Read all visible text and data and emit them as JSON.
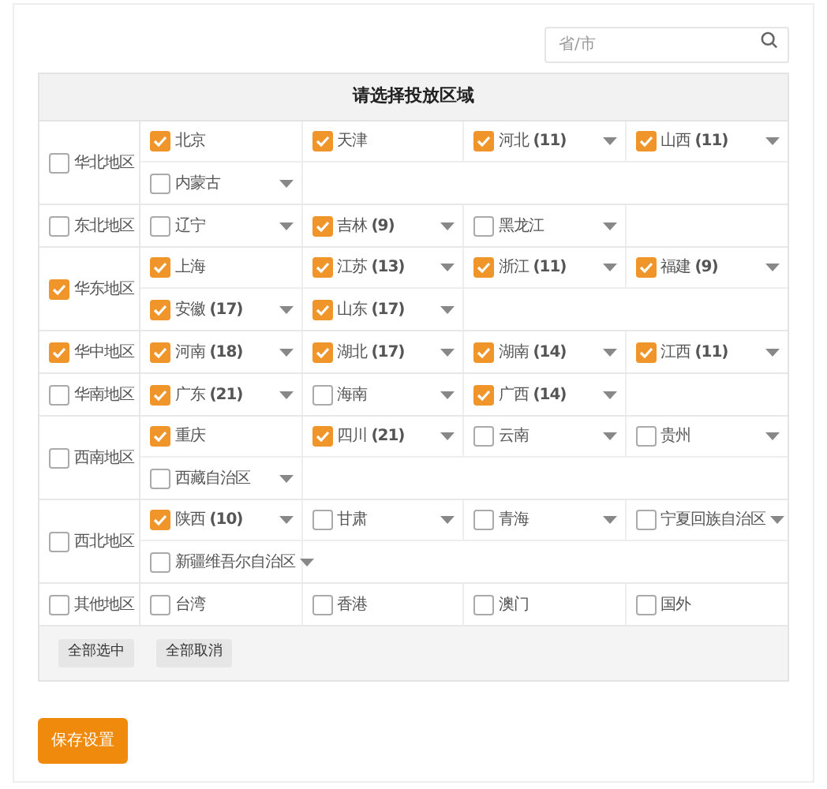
{
  "search": {
    "placeholder": "省/市"
  },
  "table": {
    "title": "请选择投放区域",
    "regions": [
      {
        "name": "华北地区",
        "checked": false,
        "rows": [
          [
            {
              "label": "北京",
              "checked": true,
              "caret": false
            },
            {
              "label": "天津",
              "checked": true,
              "caret": false
            },
            {
              "label": "河北 **(11)**",
              "checked": true,
              "caret": true
            },
            {
              "label": "山西 **(11)**",
              "checked": true,
              "caret": true
            }
          ],
          [
            {
              "label": "内蒙古",
              "checked": false,
              "caret": true
            }
          ]
        ]
      },
      {
        "name": "东北地区",
        "checked": false,
        "rows": [
          [
            {
              "label": "辽宁",
              "checked": false,
              "caret": true
            },
            {
              "label": "吉林 **(9)**",
              "checked": true,
              "caret": true
            },
            {
              "label": "黑龙江",
              "checked": false,
              "caret": true
            }
          ]
        ]
      },
      {
        "name": "华东地区",
        "checked": true,
        "rows": [
          [
            {
              "label": "上海",
              "checked": true,
              "caret": false
            },
            {
              "label": "江苏 **(13)**",
              "checked": true,
              "caret": true
            },
            {
              "label": "浙江 **(11)**",
              "checked": true,
              "caret": true
            },
            {
              "label": "福建 **(9)**",
              "checked": true,
              "caret": true
            }
          ],
          [
            {
              "label": "安徽 **(17)**",
              "checked": true,
              "caret": true
            },
            {
              "label": "山东 **(17)**",
              "checked": true,
              "caret": true
            }
          ]
        ]
      },
      {
        "name": "华中地区",
        "checked": true,
        "rows": [
          [
            {
              "label": "河南 **(18)**",
              "checked": true,
              "caret": true
            },
            {
              "label": "湖北 **(17)**",
              "checked": true,
              "caret": true
            },
            {
              "label": "湖南 **(14)**",
              "checked": true,
              "caret": true
            },
            {
              "label": "江西 **(11)**",
              "checked": true,
              "caret": true
            }
          ]
        ]
      },
      {
        "name": "华南地区",
        "checked": false,
        "rows": [
          [
            {
              "label": "广东 **(21)**",
              "checked": true,
              "caret": true
            },
            {
              "label": "海南",
              "checked": false,
              "caret": true
            },
            {
              "label": "广西 **(14)**",
              "checked": true,
              "caret": true
            }
          ]
        ]
      },
      {
        "name": "西南地区",
        "checked": false,
        "rows": [
          [
            {
              "label": "重庆",
              "checked": true,
              "caret": false
            },
            {
              "label": "四川 **(21)**",
              "checked": true,
              "caret": true
            },
            {
              "label": "云南",
              "checked": false,
              "caret": true
            },
            {
              "label": "贵州",
              "checked": false,
              "caret": true
            }
          ],
          [
            {
              "label": "西藏自治区",
              "checked": false,
              "caret": true
            }
          ]
        ]
      },
      {
        "name": "西北地区",
        "checked": false,
        "rows": [
          [
            {
              "label": "陕西 **(10)**",
              "checked": true,
              "caret": true
            },
            {
              "label": "甘肃",
              "checked": false,
              "caret": true
            },
            {
              "label": "青海",
              "checked": false,
              "caret": true
            },
            {
              "label": "宁夏回族自治区",
              "checked": false,
              "caret": true
            }
          ],
          [
            {
              "label": "新疆维吾尔自治区",
              "checked": false,
              "caret": true
            }
          ]
        ]
      },
      {
        "name": "其他地区",
        "checked": false,
        "rows": [
          [
            {
              "label": "台湾",
              "checked": false,
              "caret": false
            },
            {
              "label": "香港",
              "checked": false,
              "caret": false
            },
            {
              "label": "澳门",
              "checked": false,
              "caret": false
            },
            {
              "label": "国外",
              "checked": false,
              "caret": false
            }
          ]
        ]
      }
    ],
    "buttons": [
      "全部选中",
      "全部取消"
    ]
  },
  "save_button": "保存设置"
}
